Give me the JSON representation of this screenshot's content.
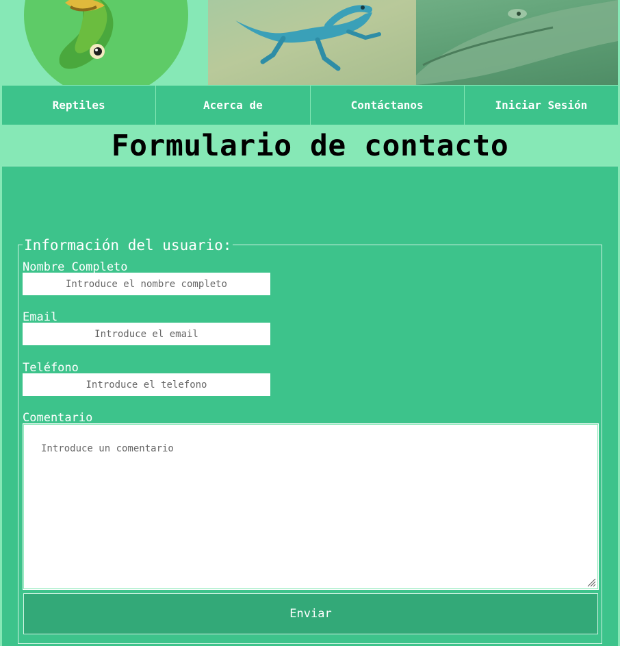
{
  "nav": {
    "items": [
      {
        "label": "Reptiles"
      },
      {
        "label": "Acerca de"
      },
      {
        "label": "Contáctanos"
      },
      {
        "label": "Iniciar Sesión"
      }
    ]
  },
  "page": {
    "title": "Formulario de contacto"
  },
  "form": {
    "legend": "Información del usuario:",
    "fields": [
      {
        "label": "Nombre Completo",
        "placeholder": "Introduce el nombre completo"
      },
      {
        "label": "Email",
        "placeholder": "Introduce el email"
      },
      {
        "label": "Teléfono",
        "placeholder": "Introduce el telefono"
      }
    ],
    "comment": {
      "label": "Comentario",
      "placeholder": "Introduce un comentario"
    },
    "submit_label": "Enviar"
  },
  "colors": {
    "background": "#3dc38b",
    "light_green": "#86e8b6",
    "button": "#33a978"
  }
}
